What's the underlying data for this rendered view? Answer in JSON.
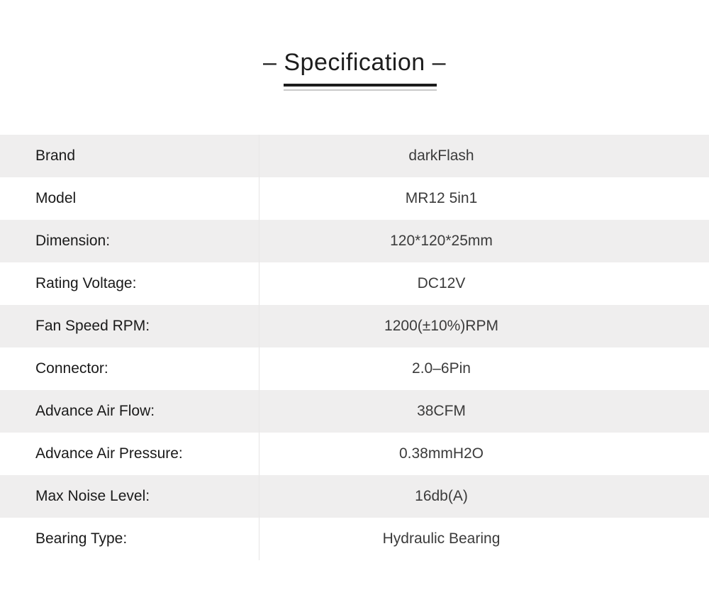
{
  "header": {
    "title": "– Specification –"
  },
  "spec_table": {
    "rows": [
      {
        "label": "Brand",
        "value": "darkFlash"
      },
      {
        "label": "Model",
        "value": "MR12 5in1"
      },
      {
        "label": "Dimension:",
        "value": "120*120*25mm"
      },
      {
        "label": "Rating Voltage:",
        "value": "DC12V"
      },
      {
        "label": "Fan Speed RPM:",
        "value": "1200(±10%)RPM"
      },
      {
        "label": "Connector:",
        "value": "2.0–6Pin"
      },
      {
        "label": "Advance Air Flow:",
        "value": "38CFM"
      },
      {
        "label": "Advance Air Pressure:",
        "value": "0.38mmH2O"
      },
      {
        "label": "Max Noise Level:",
        "value": "16db(A)"
      },
      {
        "label": "Bearing Type:",
        "value": "Hydraulic Bearing"
      }
    ]
  },
  "colors": {
    "page_background": "#ffffff",
    "row_shade": "#efeeee",
    "row_alt": "#ffffff",
    "label_text": "#1a1a1a",
    "value_text": "#3b3b3b",
    "rule_dark": "#1d1d1d",
    "rule_light": "#c9c9c9",
    "divider": "#e6e5e5"
  }
}
